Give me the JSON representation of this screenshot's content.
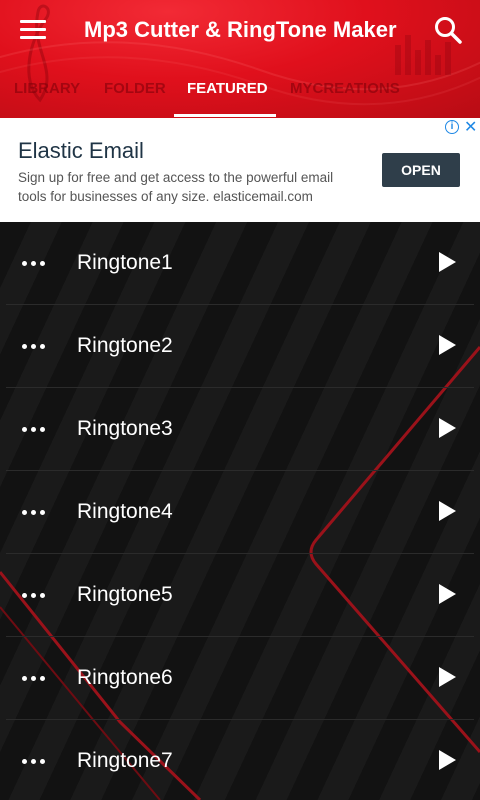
{
  "app": {
    "title": "Mp3 Cutter & RingTone Maker",
    "colors": {
      "appbar": "#e0101c",
      "accent": "#ffffff",
      "list_bg": "#121212",
      "deco_stripe": "#9a121a"
    }
  },
  "tabs": [
    {
      "label": "LIBRARY",
      "active": false
    },
    {
      "label": "FOLDER",
      "active": false
    },
    {
      "label": "FEATURED",
      "active": true
    },
    {
      "label": "MYCREATIONS",
      "active": false
    }
  ],
  "icons": {
    "menu": "hamburger-menu-icon",
    "search": "magnifier-search-icon",
    "more": "three-dots-icon",
    "play": "play-triangle-icon"
  },
  "ad": {
    "title": "Elastic Email",
    "description": "Sign up for free and get access to the powerful email tools for businesses of any size. elasticemail.com",
    "button": "OPEN",
    "info_glyph": "i",
    "close_glyph": "✕"
  },
  "ringtones": [
    {
      "label": "Ringtone1"
    },
    {
      "label": "Ringtone2"
    },
    {
      "label": "Ringtone3"
    },
    {
      "label": "Ringtone4"
    },
    {
      "label": "Ringtone5"
    },
    {
      "label": "Ringtone6"
    },
    {
      "label": "Ringtone7"
    }
  ]
}
